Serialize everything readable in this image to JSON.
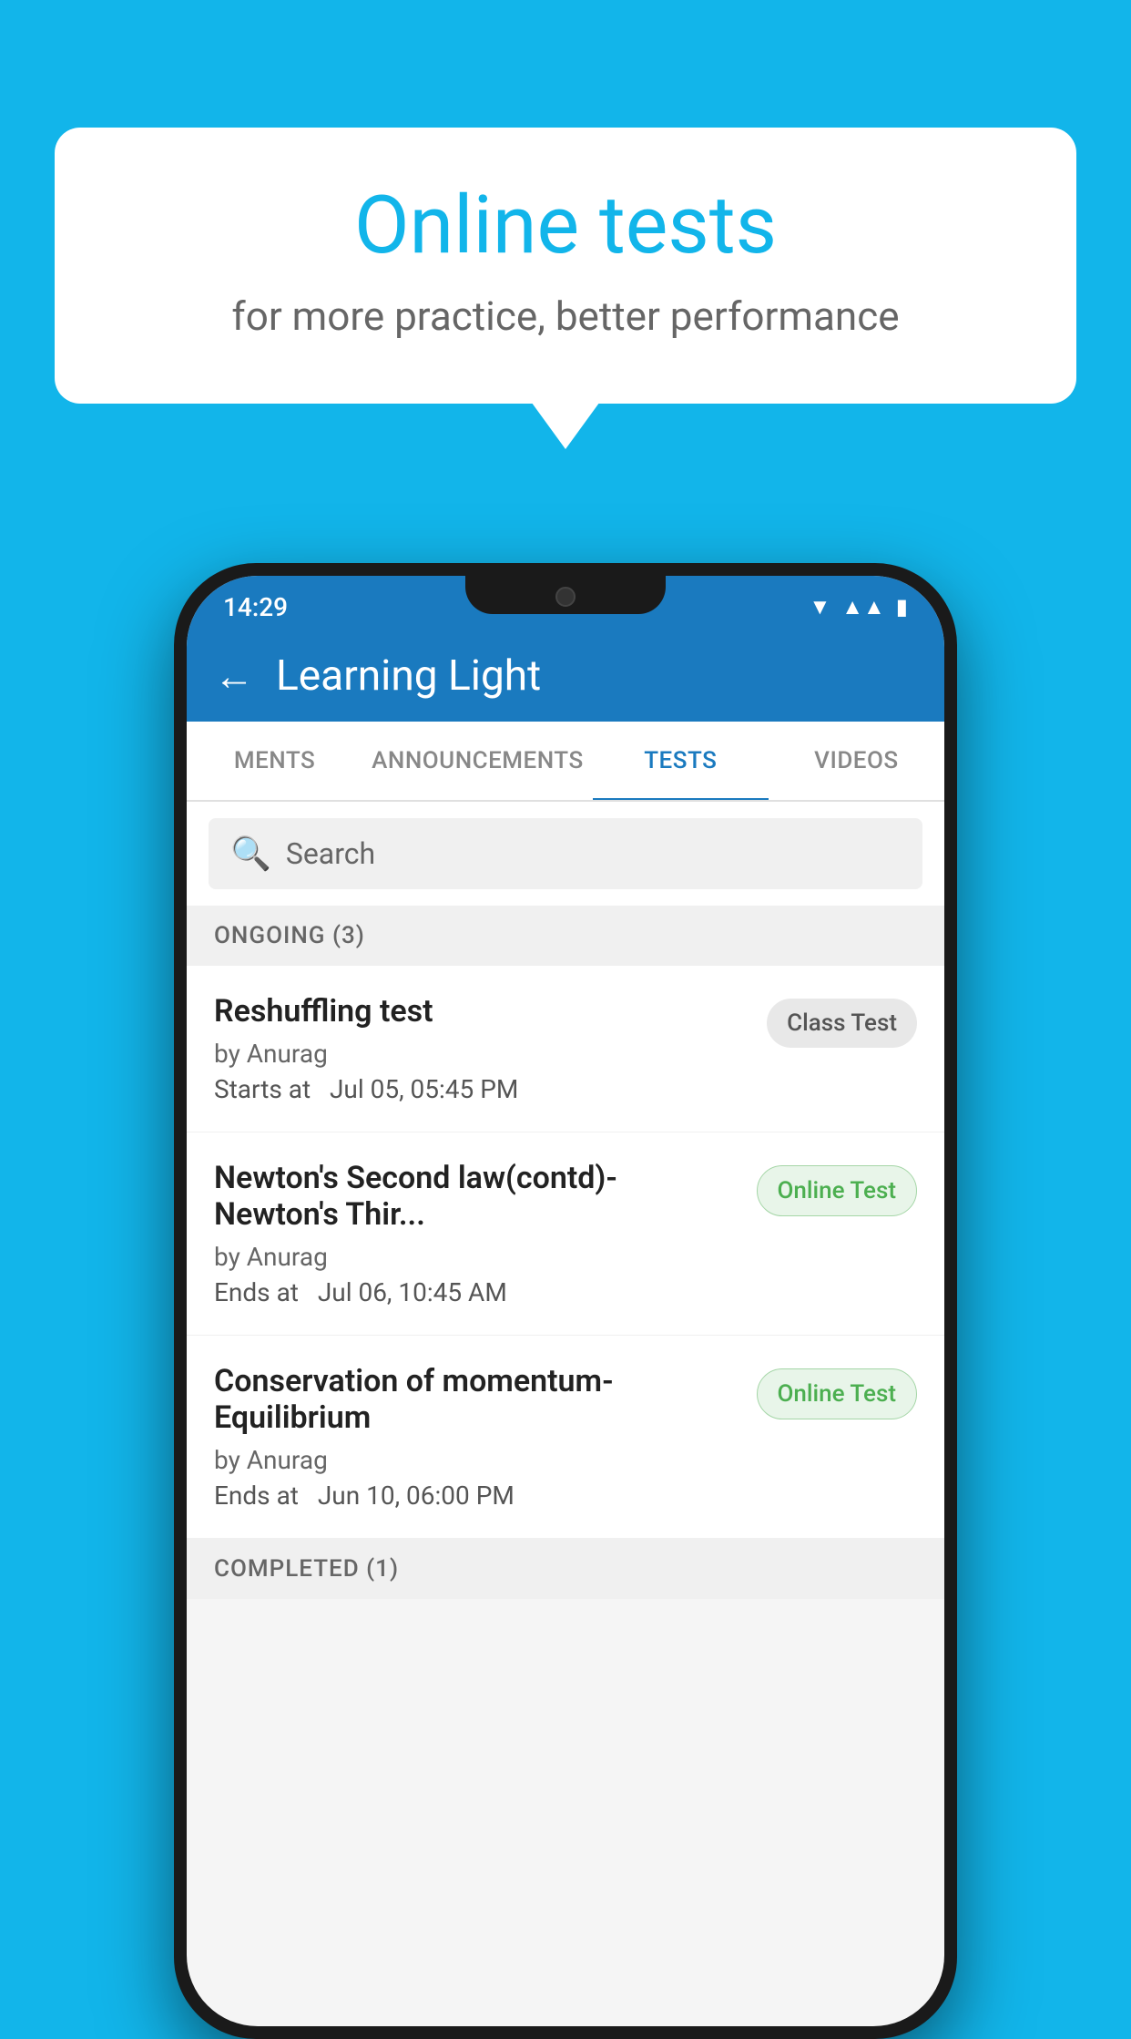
{
  "background": {
    "color": "#12B5EA"
  },
  "speech_bubble": {
    "title": "Online tests",
    "subtitle": "for more practice, better performance"
  },
  "phone": {
    "status_bar": {
      "time": "14:29",
      "icons": [
        "wifi",
        "signal",
        "battery"
      ]
    },
    "app_bar": {
      "title": "Learning Light",
      "back_label": "←"
    },
    "tabs": [
      {
        "label": "MENTS",
        "active": false
      },
      {
        "label": "ANNOUNCEMENTS",
        "active": false
      },
      {
        "label": "TESTS",
        "active": true
      },
      {
        "label": "VIDEOS",
        "active": false
      }
    ],
    "search": {
      "placeholder": "Search"
    },
    "ongoing_section": {
      "label": "ONGOING (3)"
    },
    "tests": [
      {
        "title": "Reshuffling test",
        "by": "by Anurag",
        "date_label": "Starts at",
        "date": "Jul 05, 05:45 PM",
        "badge": "Class Test",
        "badge_type": "class"
      },
      {
        "title": "Newton's Second law(contd)-Newton's Thir...",
        "by": "by Anurag",
        "date_label": "Ends at",
        "date": "Jul 06, 10:45 AM",
        "badge": "Online Test",
        "badge_type": "online"
      },
      {
        "title": "Conservation of momentum-Equilibrium",
        "by": "by Anurag",
        "date_label": "Ends at",
        "date": "Jun 10, 06:00 PM",
        "badge": "Online Test",
        "badge_type": "online"
      }
    ],
    "completed_section": {
      "label": "COMPLETED (1)"
    }
  }
}
